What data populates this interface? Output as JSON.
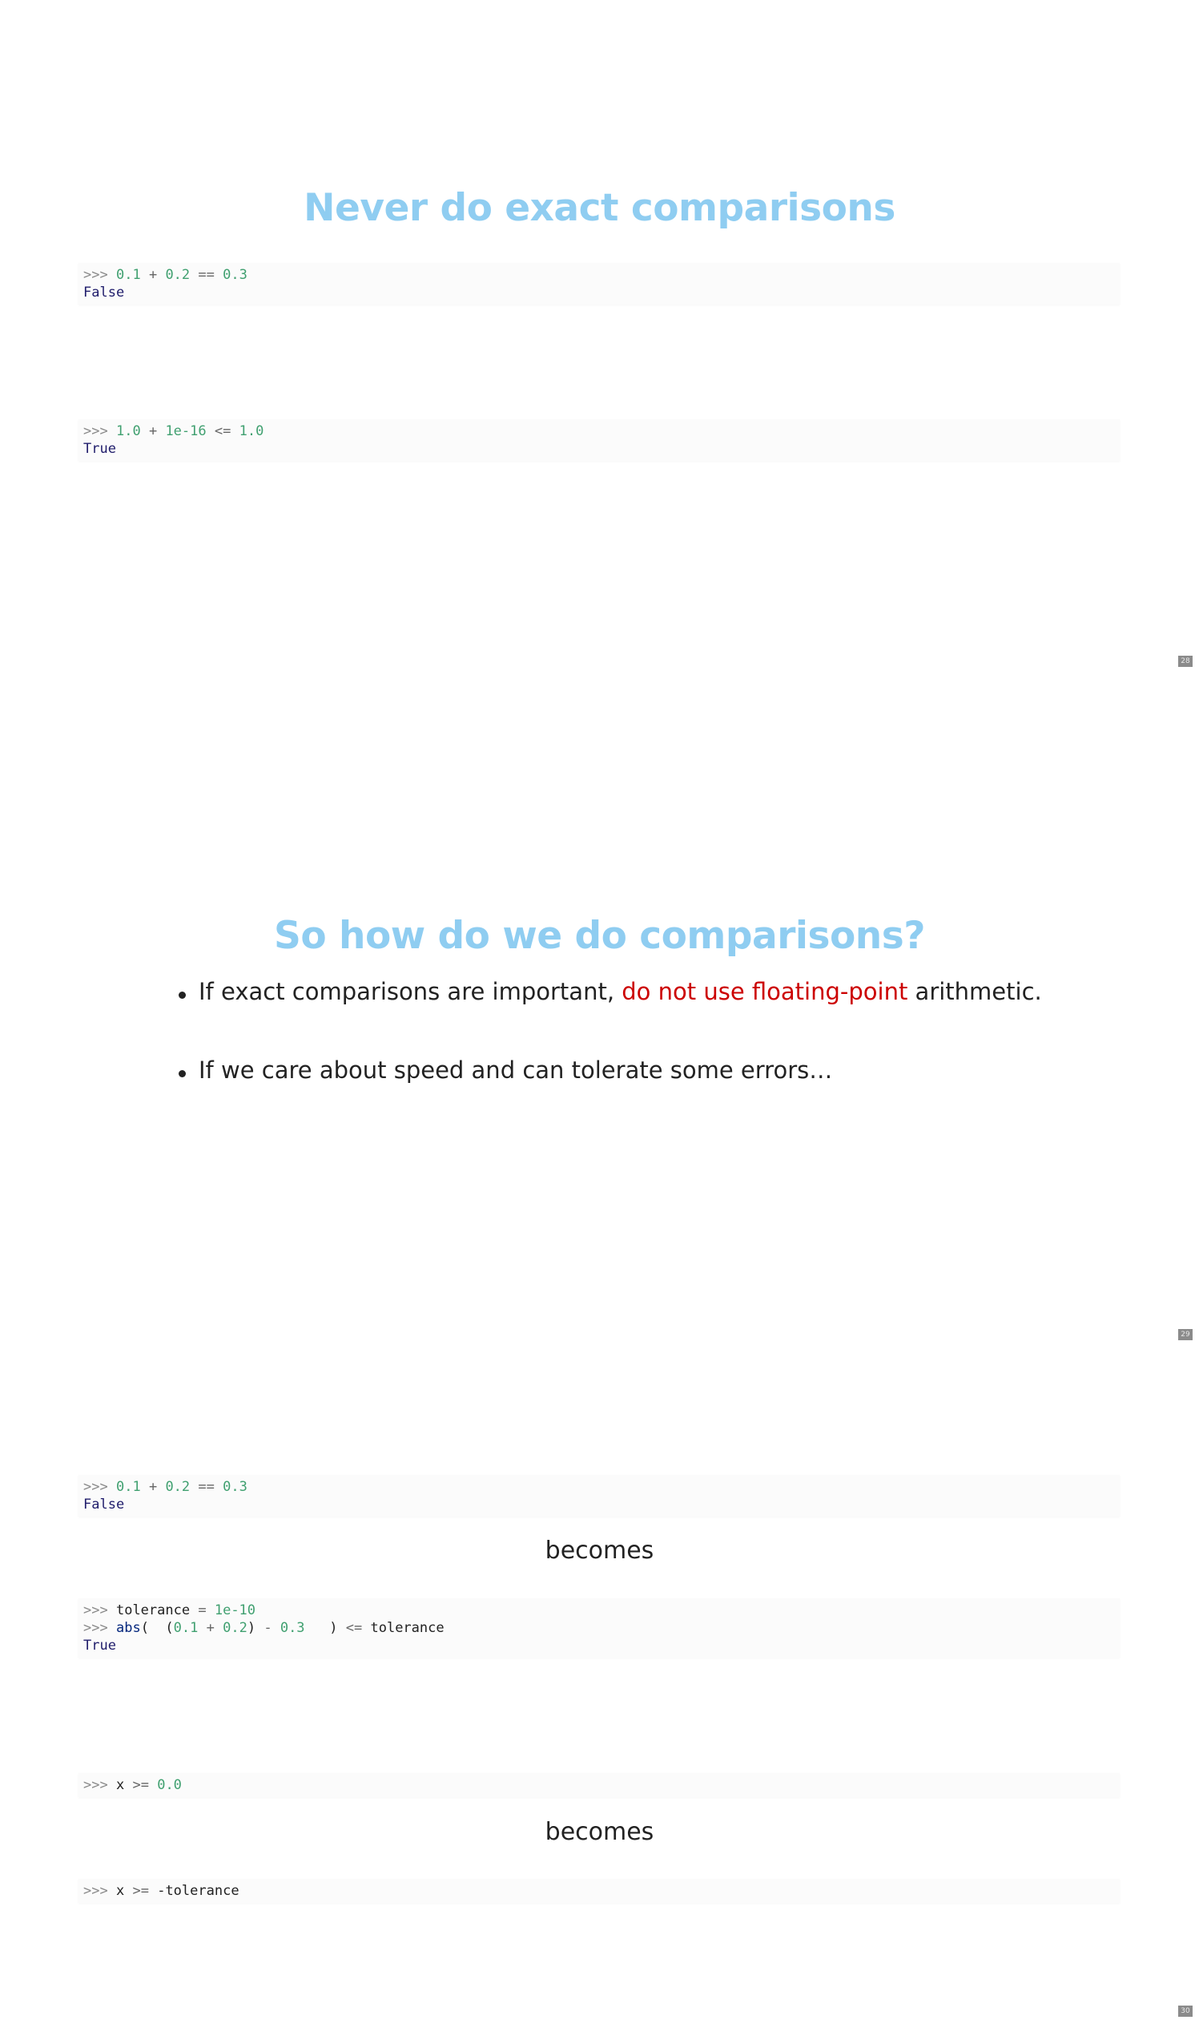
{
  "slide28": {
    "title": "Never do exact comparisons",
    "code1": {
      "line1": {
        "prompt": ">>>",
        "a": "0.1",
        "plus": "+",
        "b": "0.2",
        "op": "==",
        "c": "0.3"
      },
      "output": "False"
    },
    "code2": {
      "line1": {
        "prompt": ">>>",
        "a": "1.0",
        "plus": "+",
        "b": "1e-16",
        "op": "<=",
        "c": "1.0"
      },
      "output": "True"
    },
    "page_number": "28"
  },
  "slide29": {
    "title": "So how do we do comparisons?",
    "bullet1": {
      "before": "If exact comparisons are important, ",
      "highlight": "do not use floating-point",
      "after": " arithmetic."
    },
    "bullet2": "If we care about speed and can tolerate some errors…",
    "highlight_color": "#cc0000",
    "page_number": "29"
  },
  "slide30": {
    "code1": {
      "line1": {
        "prompt": ">>>",
        "a": "0.1",
        "plus": "+",
        "b": "0.2",
        "op": "==",
        "c": "0.3"
      },
      "output": "False"
    },
    "becomes1": "becomes",
    "code2": {
      "line1": {
        "prompt": ">>>",
        "name": "tolerance",
        "eq": "=",
        "val": "1e-10"
      },
      "line2": {
        "prompt": ">>>",
        "fn": "abs",
        "open": "(  (",
        "a": "0.1",
        "plus": "+",
        "b": "0.2",
        "close1": ")",
        "minus": "-",
        "c": "0.3",
        "close2": "   )",
        "op": "<=",
        "name": "tolerance"
      },
      "output": "True"
    },
    "code3": {
      "line1": {
        "prompt": ">>>",
        "name": "x",
        "op": ">=",
        "val": "0.0"
      }
    },
    "becomes2": "becomes",
    "code4": {
      "line1": {
        "prompt": ">>>",
        "name": "x",
        "op": ">=",
        "rest": "-tolerance"
      }
    },
    "page_number": "30"
  },
  "colors": {
    "title": "#8fcdf1",
    "code_number": "#40a070",
    "code_keyword": "#1f1c6b"
  }
}
